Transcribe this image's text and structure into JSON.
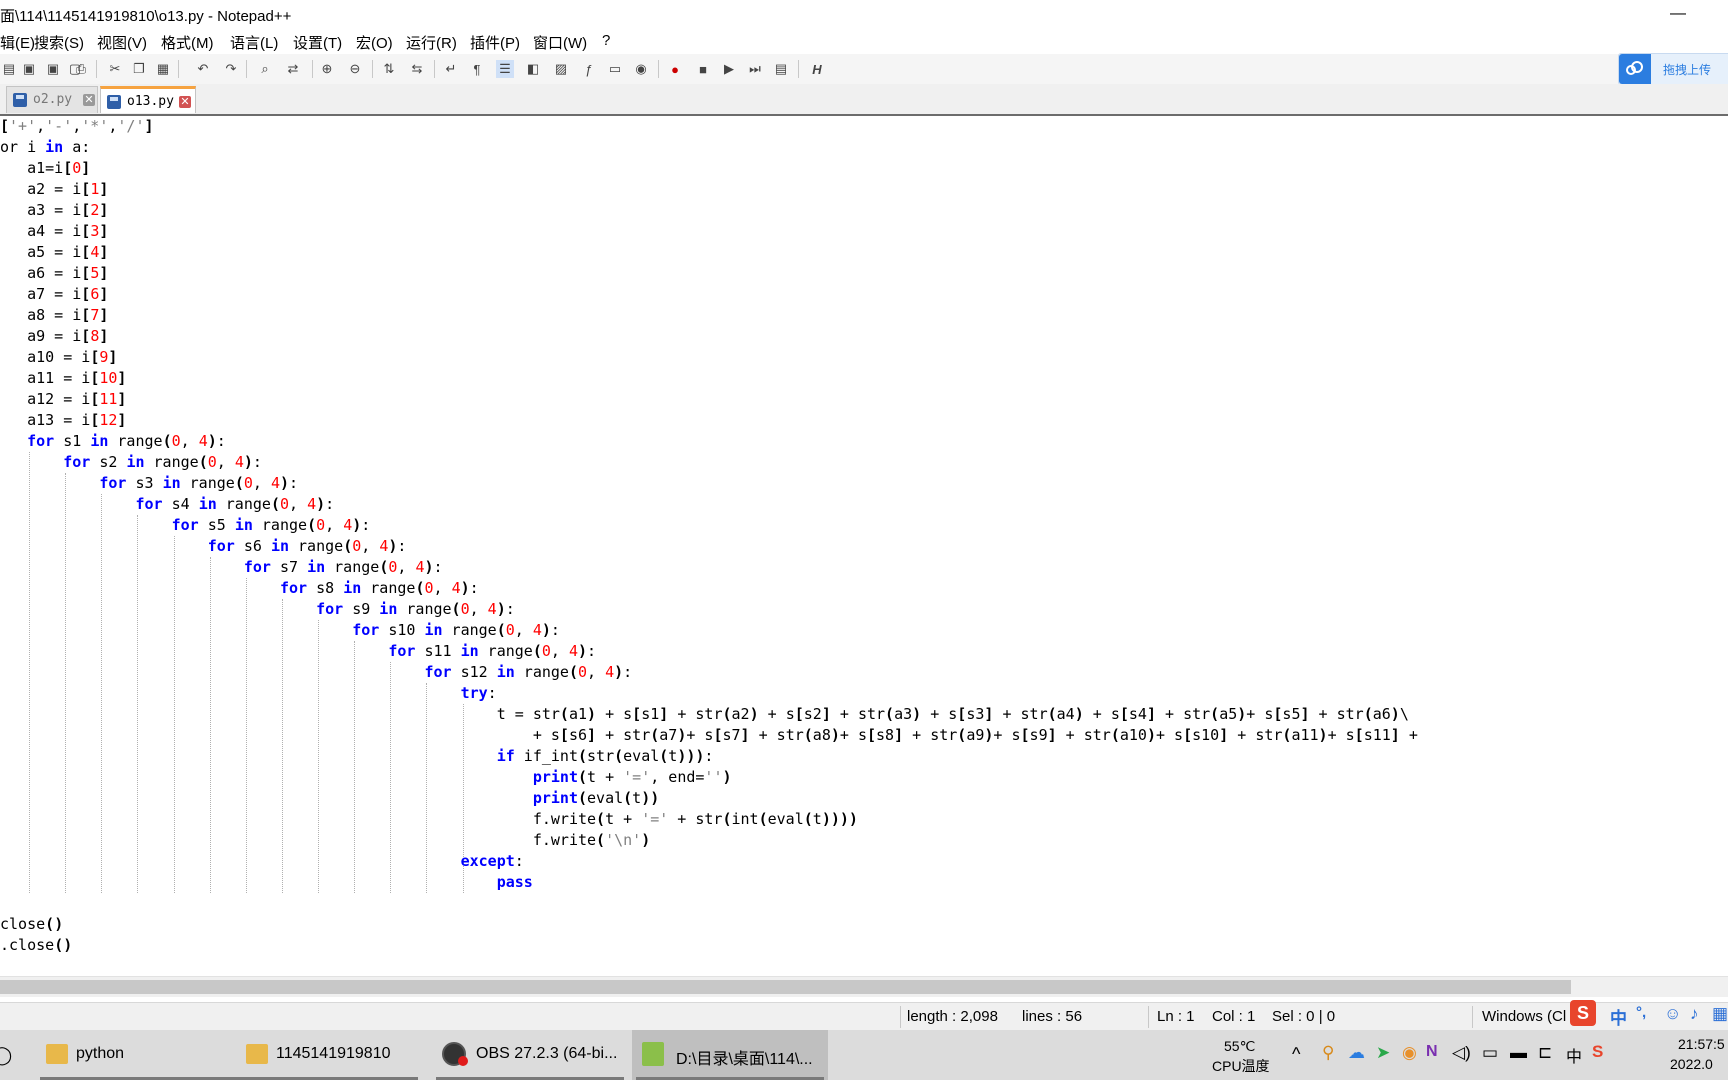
{
  "window": {
    "title": "面\\114\\1145141919810\\o13.py - Notepad++",
    "minimize_symbol": "—"
  },
  "menu": {
    "items": [
      {
        "label": "辑(E)"
      },
      {
        "label": "搜索(S)"
      },
      {
        "label": "视图(V)"
      },
      {
        "label": "格式(M)"
      },
      {
        "label": "语言(L)"
      },
      {
        "label": "设置(T)"
      },
      {
        "label": "宏(O)"
      },
      {
        "label": "运行(R)"
      },
      {
        "label": "插件(P)"
      },
      {
        "label": "窗口(W)"
      },
      {
        "label": "?"
      }
    ]
  },
  "toolbar": {
    "last_label": "H"
  },
  "upload_widget": {
    "label": "拖拽上传",
    "color": "#2b7de0"
  },
  "tabs": [
    {
      "label": "o2.py",
      "close": "✕",
      "active": false
    },
    {
      "label": "o13.py",
      "close": "✕",
      "active": true
    }
  ],
  "editor": {
    "accent_keyword": "#0000ff",
    "accent_number": "#ff0000",
    "accent_string": "#808080",
    "lines": [
      "['+','-','*','/']",
      "or i in a:",
      "   a1=i[0]",
      "   a2 = i[1]",
      "   a3 = i[2]",
      "   a4 = i[3]",
      "   a5 = i[4]",
      "   a6 = i[5]",
      "   a7 = i[6]",
      "   a8 = i[7]",
      "   a9 = i[8]",
      "   a10 = i[9]",
      "   a11 = i[10]",
      "   a12 = i[11]",
      "   a13 = i[12]",
      "   for s1 in range(0, 4):",
      "       for s2 in range(0, 4):",
      "           for s3 in range(0, 4):",
      "               for s4 in range(0, 4):",
      "                   for s5 in range(0, 4):",
      "                       for s6 in range(0, 4):",
      "                           for s7 in range(0, 4):",
      "                               for s8 in range(0, 4):",
      "                                   for s9 in range(0, 4):",
      "                                       for s10 in range(0, 4):",
      "                                           for s11 in range(0, 4):",
      "                                               for s12 in range(0, 4):",
      "                                                   try:",
      "                                                       t = str(a1) + s[s1] + str(a2) + s[s2] + str(a3) + s[s3] + str(a4) + s[s4] + str(a5)+ s[s5] + str(a6)\\",
      "                                                           + s[s6] + str(a7)+ s[s7] + str(a8)+ s[s8] + str(a9)+ s[s9] + str(a10)+ s[s10] + str(a11)+ s[s11] +",
      "                                                       if if_int(str(eval(t))):",
      "                                                           print(t + '=', end='')",
      "                                                           print(eval(t))",
      "                                                           f.write(t + '=' + str(int(eval(t))))",
      "                                                           f.write('\\n')",
      "                                                   except:",
      "                                                       pass",
      "",
      "close()",
      ".close()"
    ]
  },
  "statusbar": {
    "length": "length : 2,098",
    "lines": "lines : 56",
    "ln": "Ln : 1",
    "col": "Col : 1",
    "sel": "Sel : 0 | 0",
    "eol": "Windows (Cl"
  },
  "ime": {
    "mode": "中",
    "punct": "°,"
  },
  "taskbar": {
    "apps": [
      {
        "label": "python"
      },
      {
        "label": "1145141919810"
      },
      {
        "label": "OBS 27.2.3 (64-bi..."
      },
      {
        "label": "D:\\目录\\桌面\\114\\..."
      }
    ],
    "temp": "55℃",
    "temp_label": "CPU温度",
    "ime_lang": "中",
    "time": "21:57:5",
    "date": "2022.0"
  }
}
